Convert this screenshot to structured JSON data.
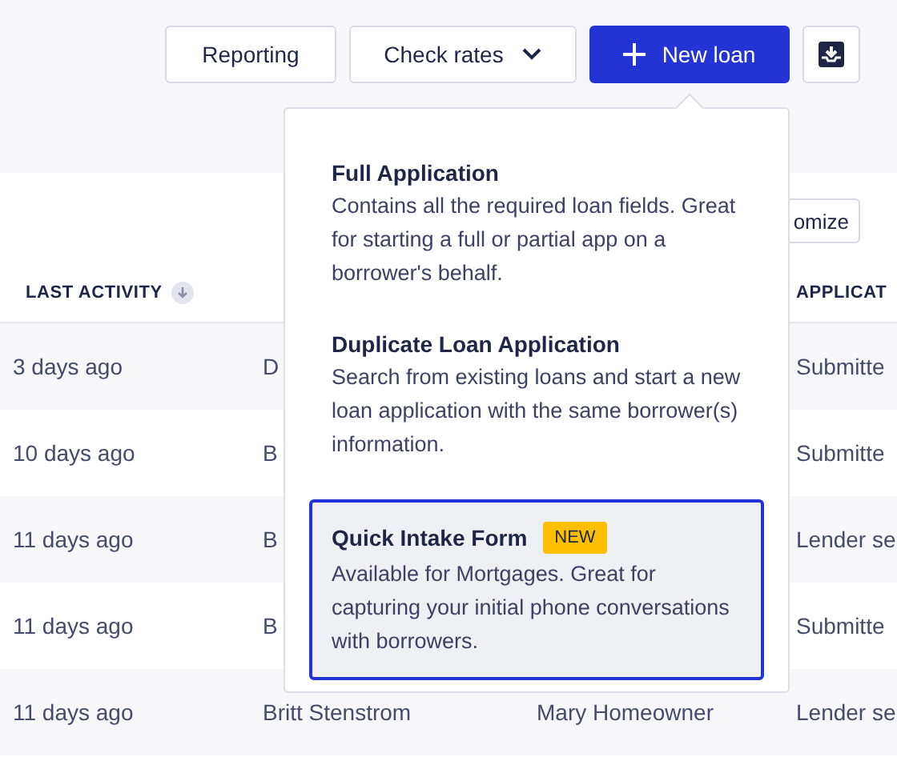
{
  "toolbar": {
    "buttons": [
      {
        "label": "Reporting",
        "kind": "plain"
      },
      {
        "label": "Check rates",
        "kind": "dropdown"
      },
      {
        "label": "New loan",
        "kind": "primary"
      },
      {
        "kind": "icon"
      }
    ]
  },
  "customize_button": {
    "label": "omize"
  },
  "table": {
    "columns": [
      {
        "label": "LAST ACTIVITY",
        "sorted": true
      },
      {},
      {},
      {
        "label": "APPLICAT",
        "sorted": false
      }
    ],
    "rows": [
      {
        "cells": [
          "3 days ago",
          "D",
          "",
          "Submitte"
        ]
      },
      {
        "cells": [
          "10 days ago",
          "B",
          "",
          "Submitte"
        ]
      },
      {
        "cells": [
          "11 days ago",
          "B",
          "",
          "Lender se"
        ]
      },
      {
        "cells": [
          "11 days ago",
          "B",
          "",
          "Submitte"
        ]
      },
      {
        "cells": [
          "11 days ago",
          "Britt Stenstrom",
          "Mary Homeowner",
          "Lender se"
        ]
      }
    ]
  },
  "menu": {
    "items": [
      {
        "title": "Full Application",
        "description": "Contains all the required loan fields. Great for starting a full or partial app on a borrower's behalf.",
        "selected": false
      },
      {
        "title": "Duplicate Loan Application",
        "description": "Search from existing loans and start a new loan application with the same borrower(s) information.",
        "selected": false
      },
      {
        "title": "Quick Intake Form",
        "badge": "NEW",
        "description": "Available for Mortgages. Great for capturing your initial phone conversations with borrowers.",
        "selected": true
      }
    ]
  }
}
